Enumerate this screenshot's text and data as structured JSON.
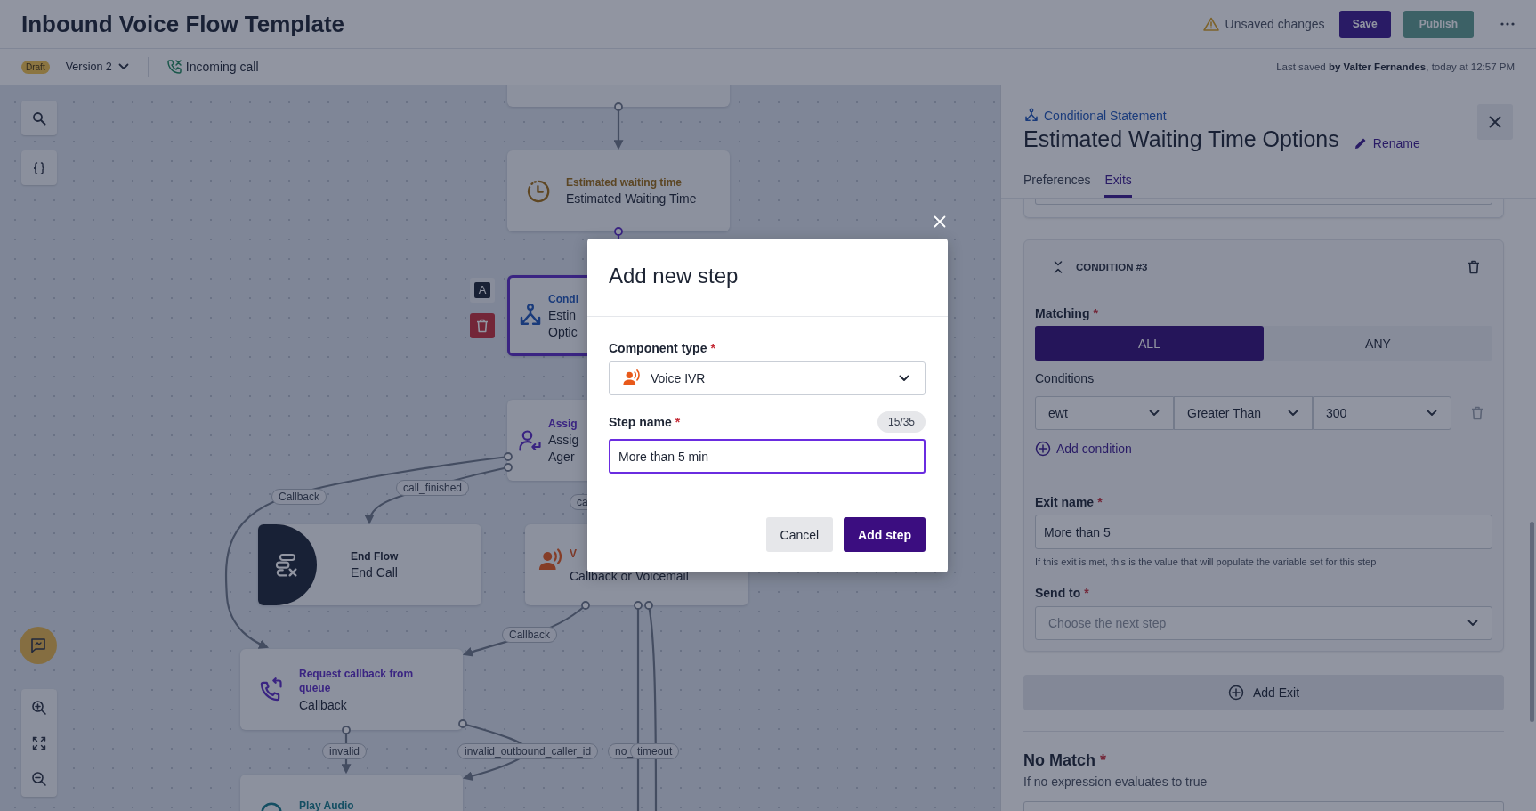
{
  "header": {
    "title": "Inbound Voice Flow Template",
    "warning": "Unsaved changes",
    "buttons": [
      {
        "label": "Save",
        "kind": "primary"
      },
      {
        "label": "Publish",
        "kind": "disabled"
      }
    ]
  },
  "subheader": {
    "status": "Draft",
    "version": "Version 2",
    "trigger": "Incoming call",
    "last_saved": "Last saved **by Valter Fernandes**, today at 12:57 PM"
  },
  "canvas": {
    "nodes": [
      {
        "kind": "blank",
        "selected": false
      },
      {
        "kind": "ewt",
        "type_label": "Estimated waiting time",
        "lines": [
          "Estimated Waiting Time"
        ],
        "selected": false
      },
      {
        "kind": "conditional",
        "type_label": "Condi",
        "lines": [
          "Estin",
          "Optic"
        ],
        "selected": true
      },
      {
        "kind": "assign",
        "type_label": "Assig",
        "lines": [
          "Assig",
          "Ager"
        ],
        "selected": false
      },
      {
        "kind": "end",
        "type_label": "End Flow",
        "lines": [
          "End Call"
        ],
        "selected": false
      },
      {
        "kind": "voice",
        "type_label": "V",
        "lines": [
          "Callback or Voicemail"
        ],
        "selected": false
      },
      {
        "kind": "callback",
        "type_label": "Request callback from queue",
        "lines": [
          "Callback"
        ],
        "selected": false
      },
      {
        "kind": "audio",
        "type_label": "Play Audio",
        "selected": false
      }
    ],
    "node_tools": {
      "text_label": "A"
    },
    "edge_labels": [
      "Callback",
      "call_finished",
      "ca",
      "Callback",
      "invalid",
      "invalid_outbound_caller_id",
      "no_",
      "timeout"
    ]
  },
  "panel": {
    "type": "Conditional Statement",
    "title": "Estimated Waiting Time Options",
    "rename": "Rename",
    "tabs": [
      {
        "label": "Preferences",
        "selected": false
      },
      {
        "label": "Exits",
        "selected": true
      }
    ],
    "condition": {
      "heading": "CONDITION #3",
      "matching_label": {
        "text": "Matching",
        "mark": "*"
      },
      "matching": [
        {
          "label": "ALL",
          "selected": true
        },
        {
          "label": "ANY",
          "selected": false
        }
      ],
      "conditions_label": "Conditions",
      "row": [
        "ewt",
        "Greater Than",
        "300"
      ],
      "add_condition": "Add condition",
      "exit_name_label": {
        "text": "Exit name",
        "mark": "*"
      },
      "exit_name": "More than 5",
      "exit_hint": "If this exit is met, this is the value that will populate the variable set for this step",
      "send_to_label": {
        "text": "Send to",
        "mark": "*"
      },
      "send_to_placeholder": "Choose the next step"
    },
    "add_exit": "Add Exit",
    "no_match": {
      "title": {
        "text": "No Match",
        "mark": "*"
      },
      "hint": "If no expression evaluates to true"
    }
  },
  "modal": {
    "title": "Add new step",
    "component_label": {
      "text": "Component type",
      "mark": "*"
    },
    "component": "Voice IVR",
    "step_label": {
      "text": "Step name",
      "mark": "*"
    },
    "counter": "15/35",
    "step_value": "More than 5 min",
    "buttons": [
      {
        "label": "Cancel",
        "kind": "secondary"
      },
      {
        "label": "Add step",
        "kind": "primary"
      }
    ]
  }
}
